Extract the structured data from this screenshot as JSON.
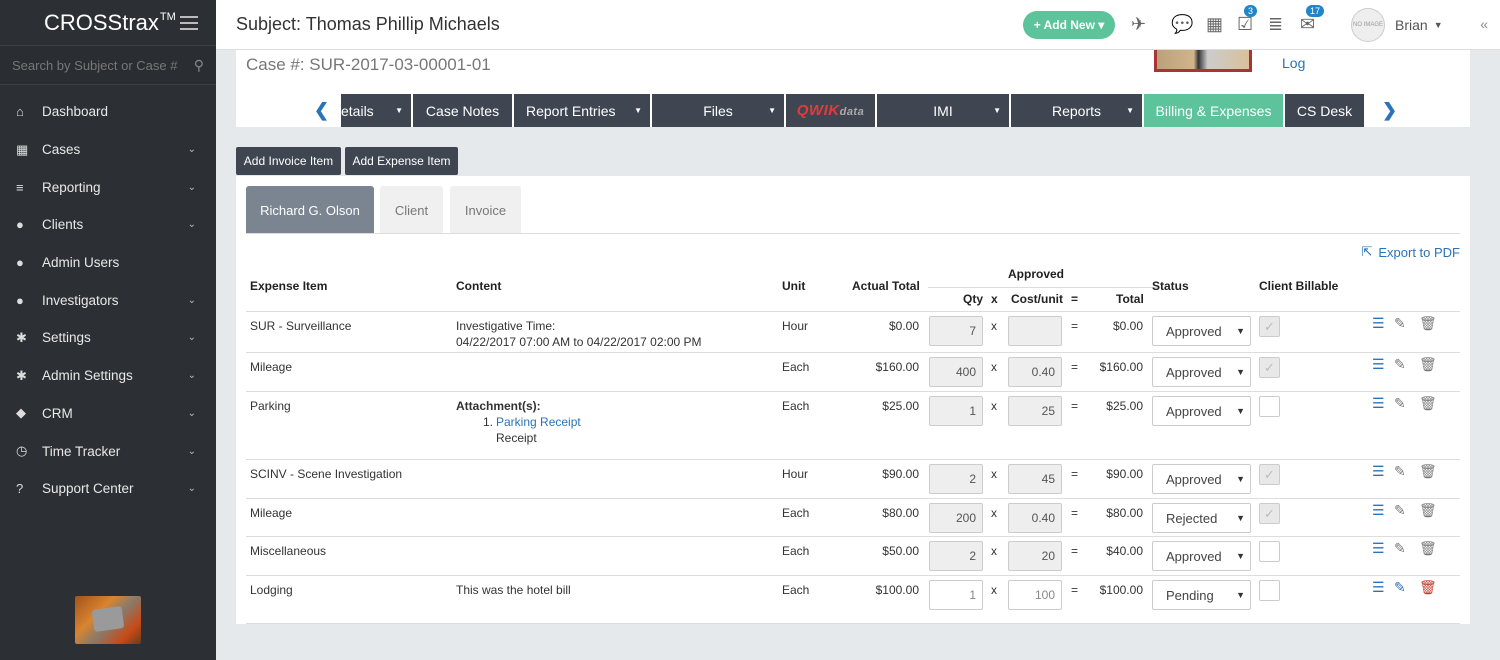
{
  "sidebar": {
    "brand": "CROSStrax",
    "brand_tm": "TM",
    "search_placeholder": "Search by Subject or Case #",
    "items": [
      {
        "label": "Dashboard",
        "icon": "home-icon",
        "glyph": "⌂",
        "chevron": false
      },
      {
        "label": "Cases",
        "icon": "grid-icon",
        "glyph": "▦",
        "chevron": true
      },
      {
        "label": "Reporting",
        "icon": "list-icon",
        "glyph": "≡",
        "chevron": true
      },
      {
        "label": "Clients",
        "icon": "user-icon",
        "glyph": "●",
        "chevron": true
      },
      {
        "label": "Admin Users",
        "icon": "user-icon",
        "glyph": "●",
        "chevron": false
      },
      {
        "label": "Investigators",
        "icon": "users-icon",
        "glyph": "●",
        "chevron": true
      },
      {
        "label": "Settings",
        "icon": "gear-icon",
        "glyph": "✱",
        "chevron": true
      },
      {
        "label": "Admin Settings",
        "icon": "gears-icon",
        "glyph": "✱",
        "chevron": true
      },
      {
        "label": "CRM",
        "icon": "cubes-icon",
        "glyph": "◆",
        "chevron": true
      },
      {
        "label": "Time Tracker",
        "icon": "clock-icon",
        "glyph": "◷",
        "chevron": true
      },
      {
        "label": "Support Center",
        "icon": "question-icon",
        "glyph": "?",
        "chevron": true
      }
    ]
  },
  "topbar": {
    "title": "Subject: Thomas Phillip Michaels",
    "add_new": "+ Add New ▾",
    "badge_tasks": "3",
    "badge_mail": "17",
    "avatar_text": "NO IMAGE",
    "user_name": "Brian"
  },
  "case": {
    "number": "Case #: SUR-2017-03-00001-01",
    "log_link": "Log",
    "tabs": [
      {
        "label": "etails",
        "dropdown": true
      },
      {
        "label": "Case Notes",
        "dropdown": false
      },
      {
        "label": "Report Entries",
        "dropdown": true
      },
      {
        "label": "Files",
        "dropdown": true
      },
      {
        "label": "QWIK",
        "dropdown": false
      },
      {
        "label": "IMI",
        "dropdown": true
      },
      {
        "label": "Reports",
        "dropdown": true
      },
      {
        "label": "Billing & Expenses",
        "dropdown": false
      },
      {
        "label": "CS Desk",
        "dropdown": false
      }
    ],
    "qwik_suffix": "data"
  },
  "buttons": {
    "add_invoice": "Add Invoice Item",
    "add_expense": "Add Expense Item"
  },
  "subtabs": [
    "Richard G. Olson",
    "Client",
    "Invoice"
  ],
  "export_label": "Export to PDF",
  "table": {
    "headers": {
      "expense_item": "Expense Item",
      "content": "Content",
      "unit": "Unit",
      "actual_total": "Actual Total",
      "approved": "Approved",
      "qty": "Qty",
      "x": "x",
      "cost_unit": "Cost/unit",
      "eq": "=",
      "total": "Total",
      "status": "Status",
      "client_billable": "Client Billable"
    },
    "rows": [
      {
        "item": "SUR - Surveillance",
        "content1": "Investigative Time:",
        "content2": "04/22/2017 07:00 AM to 04/22/2017 02:00 PM",
        "unit": "Hour",
        "actual": "$0.00",
        "qty": "7",
        "cost": "",
        "total": "$0.00",
        "status": "Approved",
        "billable": true
      },
      {
        "item": "Mileage",
        "content1": "",
        "content2": "",
        "unit": "Each",
        "actual": "$160.00",
        "qty": "400",
        "cost": "0.40",
        "total": "$160.00",
        "status": "Approved",
        "billable": true
      },
      {
        "item": "Parking",
        "content1": "Attachment(s):",
        "attach_num": "1.",
        "attach_link": "Parking Receipt",
        "attach_desc": "Receipt",
        "unit": "Each",
        "actual": "$25.00",
        "qty": "1",
        "cost": "25",
        "total": "$25.00",
        "status": "Approved",
        "billable": false
      },
      {
        "item": "SCINV - Scene Investigation",
        "content1": "",
        "content2": "",
        "unit": "Hour",
        "actual": "$90.00",
        "qty": "2",
        "cost": "45",
        "total": "$90.00",
        "status": "Approved",
        "billable": true
      },
      {
        "item": "Mileage",
        "content1": "",
        "content2": "",
        "unit": "Each",
        "actual": "$80.00",
        "qty": "200",
        "cost": "0.40",
        "total": "$80.00",
        "status": "Rejected",
        "billable": true
      },
      {
        "item": "Miscellaneous",
        "content1": "",
        "content2": "",
        "unit": "Each",
        "actual": "$50.00",
        "qty": "2",
        "cost": "20",
        "total": "$40.00",
        "status": "Approved",
        "billable": false
      },
      {
        "item": "Lodging",
        "content1": "This was the hotel bill",
        "content2": "",
        "unit": "Each",
        "actual": "$100.00",
        "qty": "1",
        "cost": "100",
        "total": "$100.00",
        "status": "Pending",
        "billable": false
      }
    ]
  },
  "colors": {
    "sidebar_bg": "#2c3034",
    "accent_green": "#5cc39a",
    "tab_dark": "#3f4652",
    "link_blue": "#2a73b8",
    "delete_red": "#c0392b"
  }
}
